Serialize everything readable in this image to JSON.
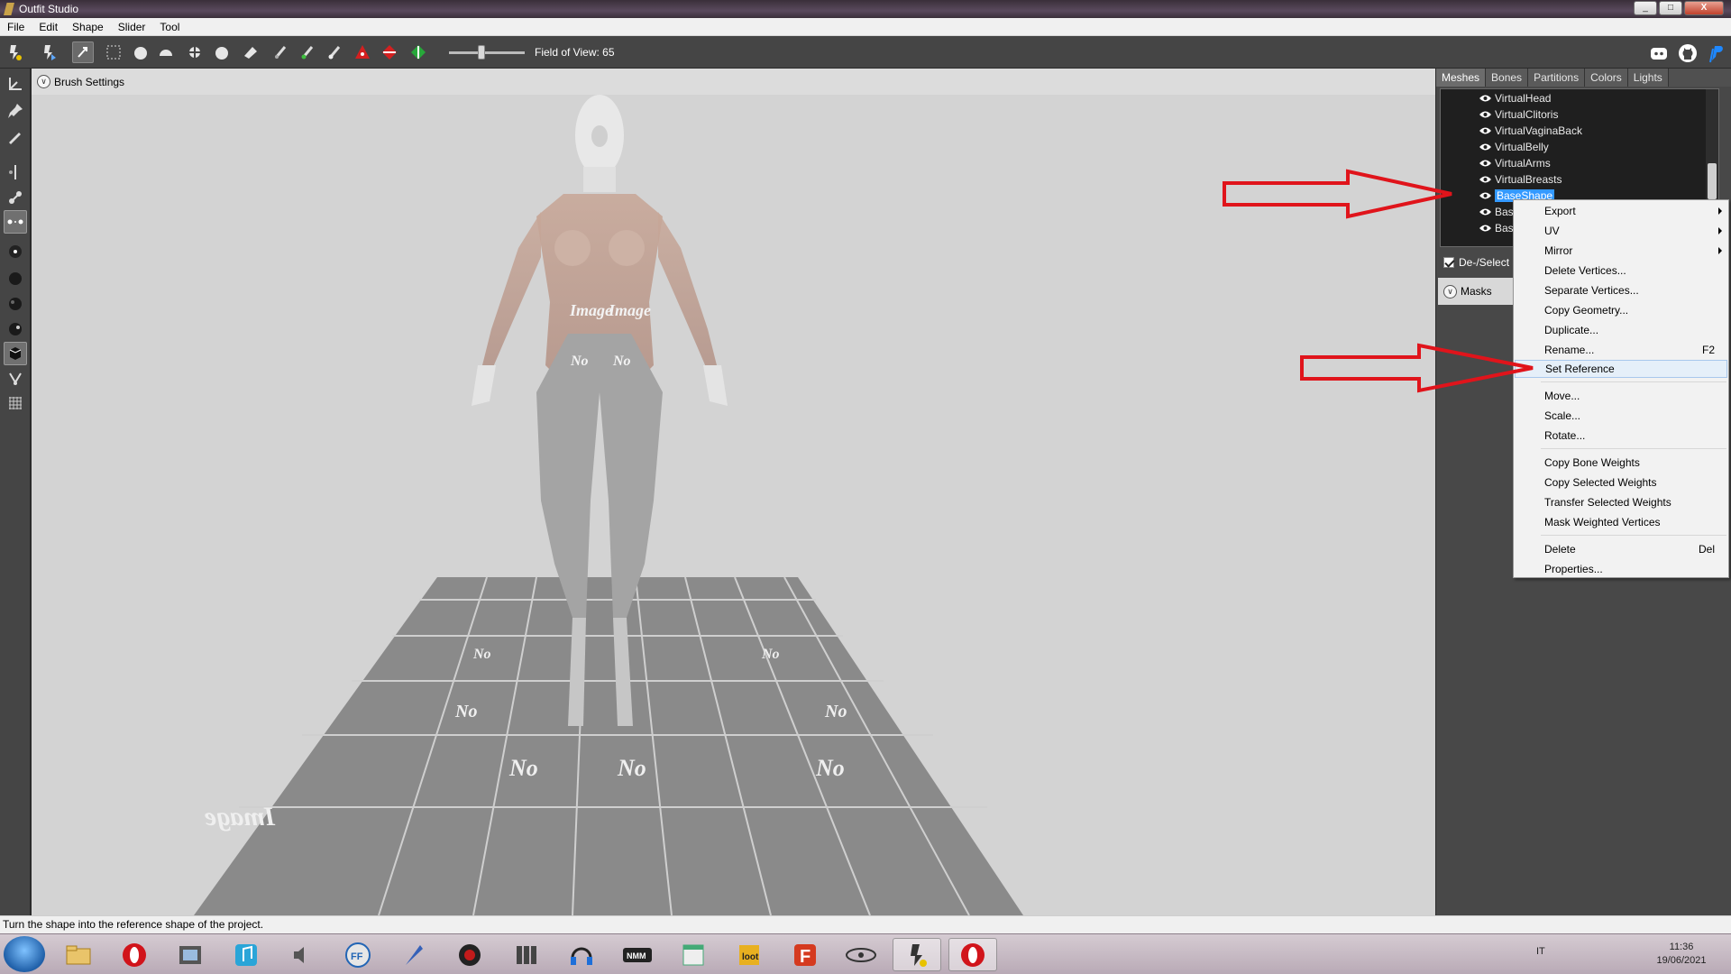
{
  "window": {
    "title": "Outfit Studio",
    "buttons": [
      "_",
      "□",
      "X"
    ]
  },
  "menubar": {
    "items": [
      "File",
      "Edit",
      "Shape",
      "Slider",
      "Tool"
    ]
  },
  "toolbar": {
    "fov_label": "Field of View: 65",
    "fov_value": 65
  },
  "viewport": {
    "brush_settings_label": "Brush Settings"
  },
  "panel": {
    "tabs": [
      "Meshes",
      "Bones",
      "Partitions",
      "Colors",
      "Lights"
    ],
    "active_tab": "Meshes",
    "meshes": [
      "VirtualHead",
      "VirtualClitoris",
      "VirtualVaginaBack",
      "VirtualBelly",
      "VirtualArms",
      "VirtualBreasts",
      "BaseShape",
      "Base",
      "Base"
    ],
    "selected_mesh": "BaseShape",
    "deselect_label": "De-/Select S",
    "masks_label": "Masks"
  },
  "context_menu": {
    "items": [
      {
        "label": "Export",
        "submenu": true
      },
      {
        "label": "UV",
        "submenu": true
      },
      {
        "label": "Mirror",
        "submenu": true
      },
      {
        "label": "Delete Vertices..."
      },
      {
        "label": "Separate Vertices..."
      },
      {
        "label": "Copy Geometry..."
      },
      {
        "label": "Duplicate..."
      },
      {
        "label": "Rename...",
        "shortcut": "F2"
      },
      {
        "label": "Set Reference",
        "highlighted": true
      },
      {
        "label": "Move..."
      },
      {
        "label": "Scale..."
      },
      {
        "label": "Rotate..."
      },
      {
        "label": "Copy Bone Weights"
      },
      {
        "label": "Copy Selected Weights"
      },
      {
        "label": "Transfer Selected Weights"
      },
      {
        "label": "Mask Weighted Vertices"
      },
      {
        "label": "Delete",
        "shortcut": "Del"
      },
      {
        "label": "Properties..."
      }
    ]
  },
  "scene": {
    "tile_text_1": "No",
    "tile_text_2": "Image"
  },
  "statusbar": {
    "text": "Turn the shape into the reference shape of the project."
  },
  "taskbar": {
    "lang": "IT",
    "time": "11:36",
    "date": "19/06/2021"
  },
  "colors": {
    "annotation_arrow": "#e0141b",
    "selection": "#3399ff",
    "viewport_bg": "#d3d3d3"
  }
}
